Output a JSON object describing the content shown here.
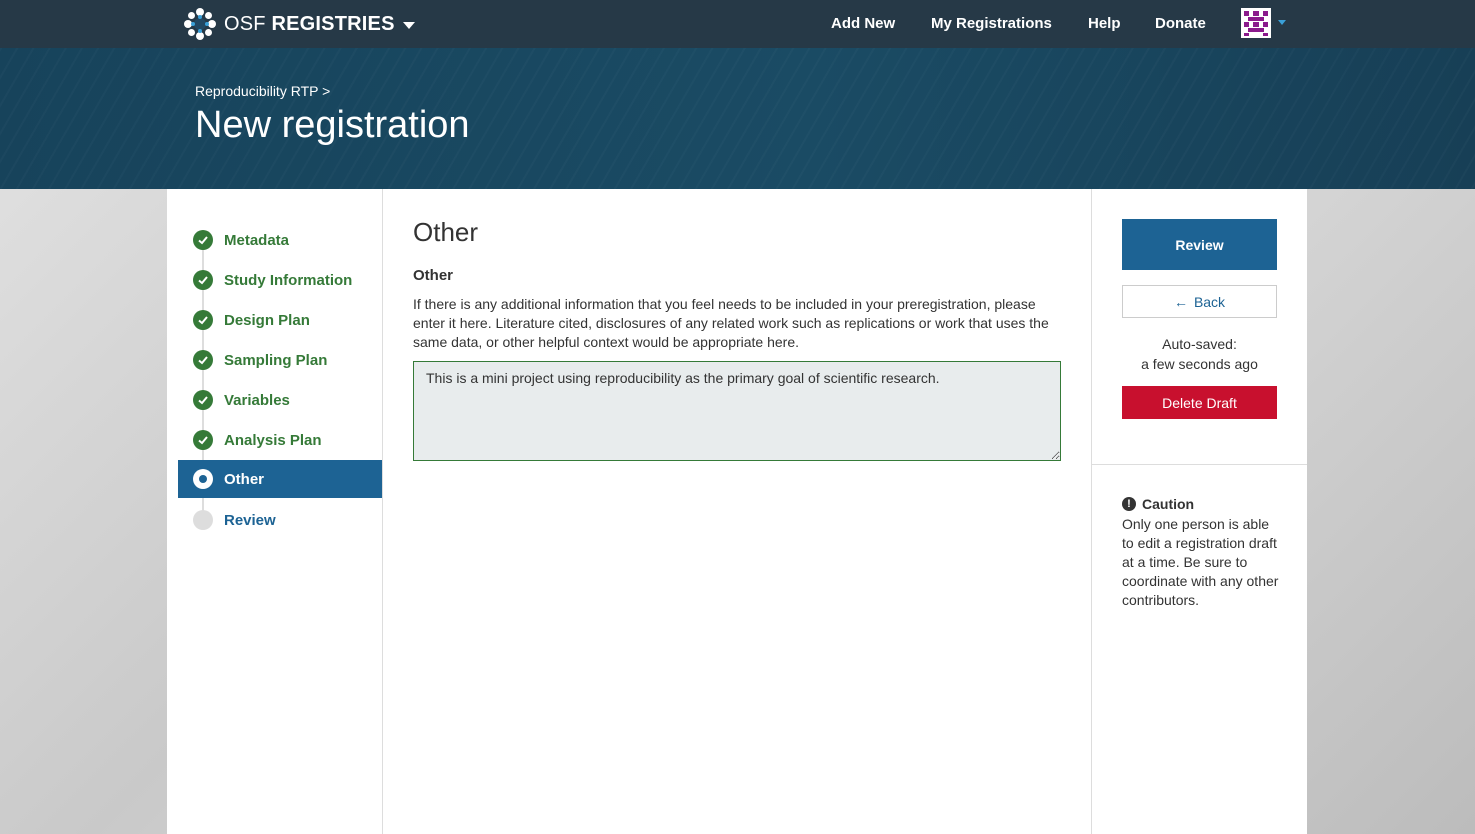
{
  "nav": {
    "brand_light": "OSF",
    "brand_bold": "REGISTRIES",
    "links": [
      "Add New",
      "My Registrations",
      "Help",
      "Donate"
    ]
  },
  "hero": {
    "breadcrumb": "Reproducibility RTP >",
    "title": "New registration"
  },
  "stepper": {
    "steps": [
      {
        "label": "Metadata",
        "state": "done"
      },
      {
        "label": "Study Information",
        "state": "done"
      },
      {
        "label": "Design Plan",
        "state": "done"
      },
      {
        "label": "Sampling Plan",
        "state": "done"
      },
      {
        "label": "Variables",
        "state": "done"
      },
      {
        "label": "Analysis Plan",
        "state": "done"
      },
      {
        "label": "Other",
        "state": "current"
      },
      {
        "label": "Review",
        "state": "todo"
      }
    ]
  },
  "main": {
    "section_title": "Other",
    "question_label": "Other",
    "question_help": "If there is any additional information that you feel needs to be included in your preregistration, please enter it here. Literature cited, disclosures of any related work such as replications or work that uses the same data, or other helpful context would be appropriate here.",
    "answer": "This is a mini project using reproducibility as the primary goal of scientific research."
  },
  "sidebar": {
    "review_label": "Review",
    "back_label": "Back",
    "autosave_line1": "Auto-saved:",
    "autosave_line2": "a few seconds ago",
    "delete_label": "Delete Draft",
    "caution_title": "Caution",
    "caution_text": "Only one person is able to edit a registration draft at a time. Be sure to coordinate with any other contributors."
  },
  "colors": {
    "nav_bg": "#263947",
    "hero_bg": "#15435c",
    "primary": "#1d6394",
    "success": "#357a38",
    "danger": "#c8102e"
  },
  "icons": [
    "osf-logo-icon",
    "caret-down-icon",
    "user-avatar-icon",
    "check-icon",
    "arrow-left-icon",
    "exclamation-circle-icon"
  ]
}
